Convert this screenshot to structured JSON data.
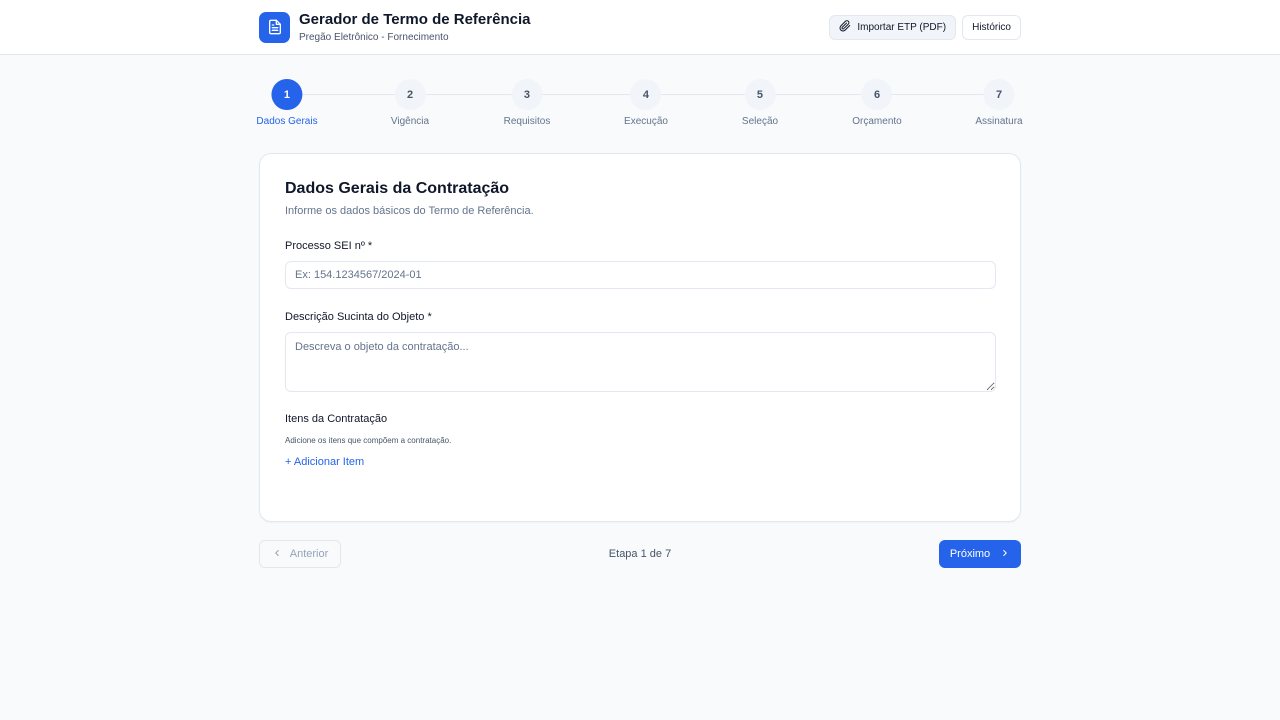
{
  "header": {
    "title": "Gerador de Termo de Referência",
    "subtitle": "Pregão Eletrônico - Fornecimento",
    "logo_icon": "document-icon",
    "import_button": {
      "label": "Importar ETP (PDF)",
      "icon": "paperclip-icon"
    },
    "history_button": {
      "label": "Histórico"
    }
  },
  "stepper": {
    "current": 1,
    "steps": [
      {
        "number": "1",
        "label": "Dados Gerais"
      },
      {
        "number": "2",
        "label": "Vigência"
      },
      {
        "number": "3",
        "label": "Requisitos"
      },
      {
        "number": "4",
        "label": "Execução"
      },
      {
        "number": "5",
        "label": "Seleção"
      },
      {
        "number": "6",
        "label": "Orçamento"
      },
      {
        "number": "7",
        "label": "Assinatura"
      }
    ]
  },
  "form": {
    "title": "Dados Gerais da Contratação",
    "subtitle": "Informe os dados básicos do Termo de Referência.",
    "processo": {
      "label": "Processo SEI nº *",
      "value": "",
      "placeholder": "Ex: 154.1234567/2024-01"
    },
    "descricao": {
      "label": "Descrição Sucinta do Objeto *",
      "value": "",
      "placeholder": "Descreva o objeto da contratação..."
    },
    "itens": {
      "title": "Itens da Contratação",
      "hint": "Adicione os itens que compõem a contratação.",
      "add_label": "+ Adicionar Item"
    }
  },
  "navigation": {
    "prev_label": "Anterior",
    "next_label": "Próximo",
    "counter": "Etapa 1 de 7"
  },
  "colors": {
    "accent": "#2563eb",
    "background": "#f8fafc",
    "border": "#e2e8f0",
    "muted_text": "#64748b"
  }
}
